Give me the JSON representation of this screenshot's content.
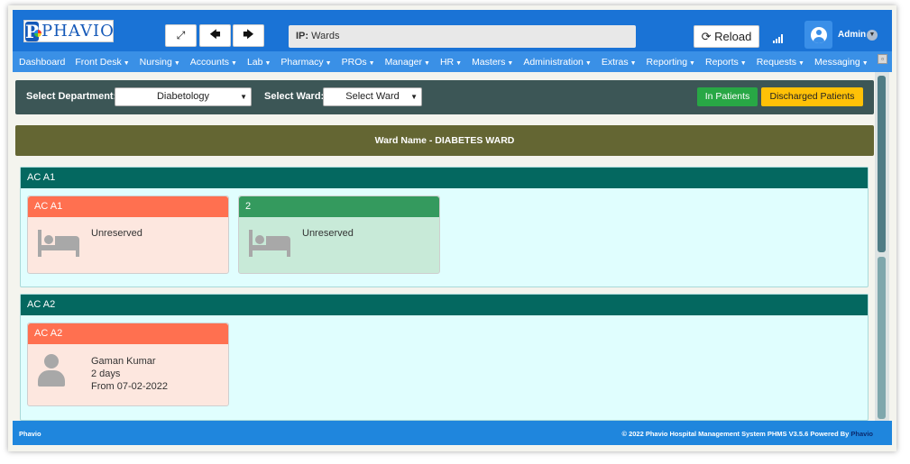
{
  "app": {
    "logo_text": "PHAVIO",
    "logo_initial": "P"
  },
  "header": {
    "fullscreen_icon": "expand-icon",
    "back_icon": "arrow-left-icon",
    "forward_icon": "arrow-right-icon",
    "search_label": "IP:",
    "search_value": "Wards",
    "reload_icon_glyph": "⟳",
    "reload_label": "Reload",
    "user_name": "Admin"
  },
  "nav": {
    "items": [
      {
        "label": "Dashboard",
        "dropdown": false
      },
      {
        "label": "Front Desk",
        "dropdown": true
      },
      {
        "label": "Nursing",
        "dropdown": true
      },
      {
        "label": "Accounts",
        "dropdown": true
      },
      {
        "label": "Lab",
        "dropdown": true
      },
      {
        "label": "Pharmacy",
        "dropdown": true
      },
      {
        "label": "PROs",
        "dropdown": true
      },
      {
        "label": "Manager",
        "dropdown": true
      },
      {
        "label": "HR",
        "dropdown": true
      },
      {
        "label": "Masters",
        "dropdown": true
      },
      {
        "label": "Administration",
        "dropdown": true
      },
      {
        "label": "Extras",
        "dropdown": true
      },
      {
        "label": "Reporting",
        "dropdown": true
      },
      {
        "label": "Reports",
        "dropdown": true
      },
      {
        "label": "Requests",
        "dropdown": true
      },
      {
        "label": "Messaging",
        "dropdown": true
      }
    ]
  },
  "filters": {
    "department_label": "Select Department:",
    "department_value": "Diabetology",
    "ward_label": "Select Ward:",
    "ward_value": "Select Ward",
    "in_patients_label": "In Patients",
    "discharged_label": "Discharged Patients"
  },
  "ward": {
    "title": "Ward Name - DIABETES WARD"
  },
  "rooms": [
    {
      "name": "AC A1",
      "beds": [
        {
          "name": "AC A1",
          "status": "Unreserved",
          "color": "orange",
          "occupied": false
        },
        {
          "name": "2",
          "status": "Unreserved",
          "color": "green",
          "occupied": false
        }
      ]
    },
    {
      "name": "AC A2",
      "beds": [
        {
          "name": "AC A2",
          "color": "orange",
          "occupied": true,
          "patient": "Gaman Kumar",
          "duration": "2 days",
          "from": "From 07-02-2022"
        }
      ]
    }
  ],
  "footer": {
    "left": "Phavio",
    "right_prefix": "© 2022 Phavio Hospital Management System PHMS V3.5.6 Powered By ",
    "right_brand": "Phavio"
  },
  "colors": {
    "topbar": "#1a73d6",
    "navbar": "#3a90e6",
    "filter_bar": "#3c5656",
    "ward_bar": "#646633",
    "room_header": "#046860",
    "bed_orange": "#ff7050",
    "bed_green": "#349a5e",
    "in_patients": "#28a745",
    "discharged": "#ffc107"
  }
}
